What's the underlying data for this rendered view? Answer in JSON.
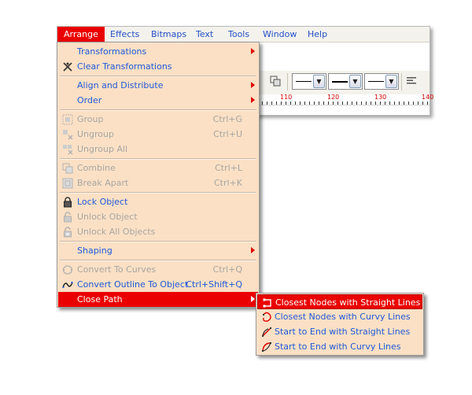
{
  "menubar": {
    "items": [
      {
        "label": "Arrange",
        "active": true
      },
      {
        "label": "Effects"
      },
      {
        "label": "Bitmaps"
      },
      {
        "label": "Text"
      },
      {
        "label": "Tools"
      },
      {
        "label": "Window"
      },
      {
        "label": "Help"
      }
    ]
  },
  "ruler": {
    "labels": [
      "110",
      "120",
      "130",
      "140"
    ]
  },
  "arrange_menu": {
    "items": [
      {
        "label": "Transformations",
        "submenu": true
      },
      {
        "label": "Clear Transformations",
        "icon": "clear-transform-icon"
      },
      {
        "label": "Align and Distribute",
        "submenu": true
      },
      {
        "label": "Order",
        "submenu": true
      },
      {
        "label": "Group",
        "shortcut": "Ctrl+G",
        "disabled": true,
        "icon": "group-icon"
      },
      {
        "label": "Ungroup",
        "shortcut": "Ctrl+U",
        "disabled": true,
        "icon": "ungroup-icon"
      },
      {
        "label": "Ungroup All",
        "disabled": true,
        "icon": "ungroup-all-icon"
      },
      {
        "label": "Combine",
        "shortcut": "Ctrl+L",
        "disabled": true,
        "icon": "combine-icon"
      },
      {
        "label": "Break  Apart",
        "shortcut": "Ctrl+K",
        "disabled": true,
        "icon": "break-apart-icon"
      },
      {
        "label": "Lock Object",
        "icon": "lock-icon"
      },
      {
        "label": "Unlock Object",
        "disabled": true,
        "icon": "unlock-icon"
      },
      {
        "label": "Unlock All Objects",
        "disabled": true,
        "icon": "unlock-all-icon"
      },
      {
        "label": "Shaping",
        "submenu": true
      },
      {
        "label": "Convert To Curves",
        "shortcut": "Ctrl+Q",
        "disabled": true,
        "icon": "convert-curves-icon"
      },
      {
        "label": "Convert Outline To Object",
        "shortcut": "Ctrl+Shift+Q",
        "icon": "convert-outline-icon"
      },
      {
        "label": "Close Path",
        "submenu": true,
        "highlighted": true
      }
    ]
  },
  "close_path_submenu": {
    "items": [
      {
        "label": "Closest Nodes with Straight Lines",
        "highlighted": true,
        "icon": "closest-straight-icon"
      },
      {
        "label": "Closest Nodes with Curvy Lines",
        "icon": "closest-curvy-icon"
      },
      {
        "label": "Start to End with Straight Lines",
        "icon": "start-end-straight-icon"
      },
      {
        "label": "Start to End with Curvy Lines",
        "icon": "start-end-curvy-icon"
      }
    ]
  },
  "colors": {
    "menu_background": "#fbe0c5",
    "highlight": "#ea0000",
    "enabled_text": "#2058d8",
    "disabled_text": "#a8a6a2"
  }
}
